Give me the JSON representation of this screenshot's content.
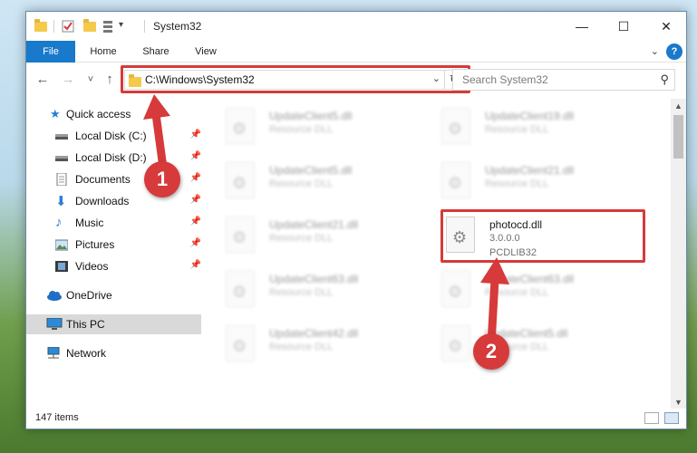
{
  "window": {
    "title": "System32",
    "minimize_glyph": "—",
    "maximize_glyph": "☐",
    "close_glyph": "✕"
  },
  "ribbon": {
    "tabs": [
      {
        "label": "File"
      },
      {
        "label": "Home"
      },
      {
        "label": "Share"
      },
      {
        "label": "View"
      }
    ],
    "expand_glyph": "⌄",
    "help_glyph": "?"
  },
  "nav": {
    "back_glyph": "←",
    "forward_glyph": "→",
    "recent_glyph": "˅",
    "up_glyph": "↑",
    "address": "C:\\Windows\\System32",
    "address_dropdown_glyph": "⌄",
    "refresh_glyph": "↻",
    "search_placeholder": "Search System32",
    "search_glyph": "⚲"
  },
  "sidebar": {
    "items": [
      {
        "label": "Quick access",
        "icon": "star-icon",
        "pinned": false
      },
      {
        "label": "Local Disk (C:)",
        "icon": "drive-icon",
        "pinned": true
      },
      {
        "label": "Local Disk (D:)",
        "icon": "drive-icon",
        "pinned": true
      },
      {
        "label": "Documents",
        "icon": "documents-icon",
        "pinned": true
      },
      {
        "label": "Downloads",
        "icon": "download-icon",
        "pinned": true
      },
      {
        "label": "Music",
        "icon": "music-icon",
        "pinned": true
      },
      {
        "label": "Pictures",
        "icon": "pictures-icon",
        "pinned": true
      },
      {
        "label": "Videos",
        "icon": "videos-icon",
        "pinned": true
      },
      {
        "label": "OneDrive",
        "icon": "cloud-icon",
        "pinned": false
      },
      {
        "label": "This PC",
        "icon": "computer-icon",
        "pinned": false,
        "selected": true
      },
      {
        "label": "Network",
        "icon": "network-icon",
        "pinned": false
      }
    ],
    "pin_glyph": "📌"
  },
  "files": {
    "left_column": [
      {
        "name": "UpdateClient5.dll",
        "detail": "Resource DLL"
      },
      {
        "name": "UpdateClient5.dll",
        "detail": "Resource DLL"
      },
      {
        "name": "UpdateClient21.dll",
        "detail": "Resource DLL"
      },
      {
        "name": "UpdateClient63.dll",
        "detail": "Resource DLL"
      },
      {
        "name": "UpdateClient42.dll",
        "detail": "Resource DLL"
      }
    ],
    "right_column": [
      {
        "name": "UpdateClient19.dll",
        "detail": "Resource DLL"
      },
      {
        "name": "UpdateClient21.dll",
        "detail": "Resource DLL"
      },
      {
        "name": "photocd.dll",
        "version": "3.0.0.0",
        "company": "PCDLIB32",
        "highlighted": true
      },
      {
        "name": "UpdateClient63.dll",
        "detail": "Resource DLL"
      },
      {
        "name": "UpdateClient5.dll",
        "detail": "Resource DLL"
      }
    ]
  },
  "status": {
    "item_count": "147 items"
  },
  "annotations": {
    "step1": "1",
    "step2": "2",
    "color": "#d63a3a"
  }
}
